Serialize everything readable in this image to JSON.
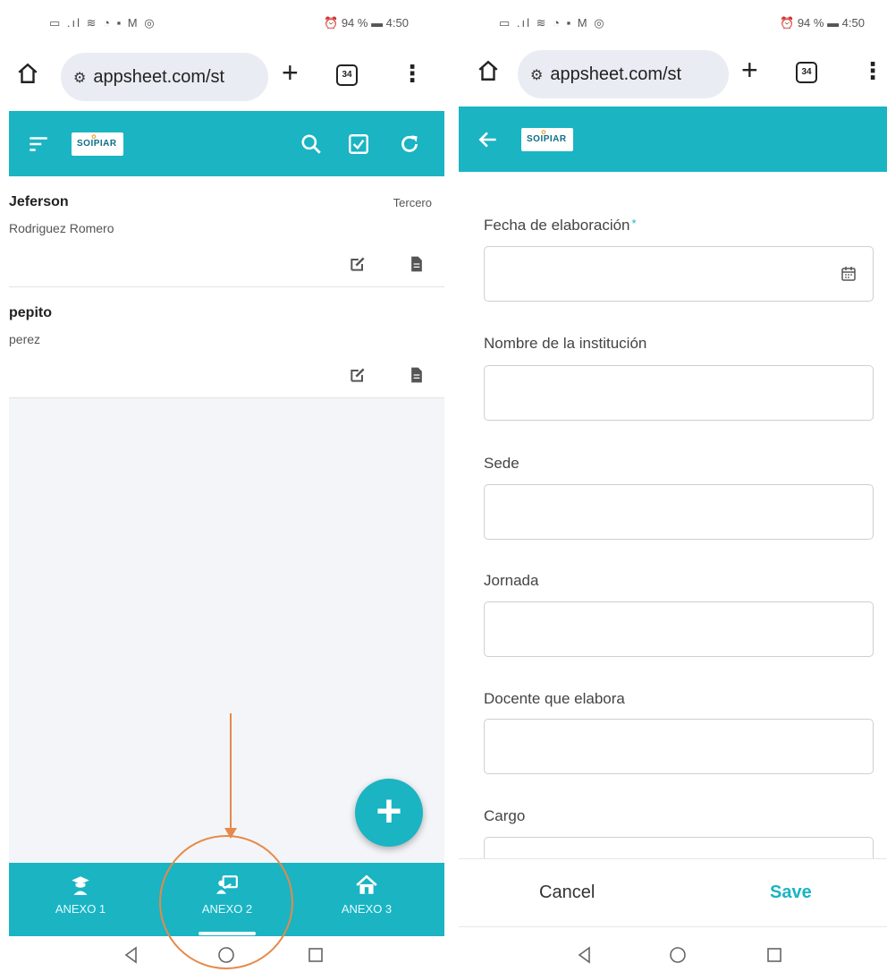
{
  "status_bar": {
    "left_icons": "▭ .ıl ≋ ◔ ▪ M ◎",
    "right": "⏰ 94 % ▬ 4:50"
  },
  "browser": {
    "url": "appsheet.com/st",
    "tabs_count": "34"
  },
  "left_screen": {
    "rows": [
      {
        "name": "Jeferson",
        "surname": "Rodriguez Romero",
        "grade": "Tercero"
      },
      {
        "name": "pepito",
        "surname": "perez",
        "grade": ""
      }
    ],
    "fab_symbol": "+",
    "nav": [
      {
        "label": "ANEXO 1",
        "icon": "student-icon"
      },
      {
        "label": "ANEXO 2",
        "icon": "teacher-board-icon",
        "active": true
      },
      {
        "label": "ANEXO 3",
        "icon": "school-house-icon"
      }
    ]
  },
  "right_screen": {
    "fields": [
      {
        "label": "Fecha de elaboración",
        "required": "*",
        "value": ""
      },
      {
        "label": "Nombre de la institución",
        "value": ""
      },
      {
        "label": "Sede",
        "value": ""
      },
      {
        "label": "Jornada",
        "value": ""
      },
      {
        "label": "Docente que elabora",
        "value": ""
      },
      {
        "label": "Cargo",
        "value": ""
      }
    ],
    "cancel_label": "Cancel",
    "save_label": "Save"
  },
  "logo_text": "SOIPIAR",
  "colors": {
    "primary": "#1ab4c3",
    "annotation": "#e58a4a"
  }
}
